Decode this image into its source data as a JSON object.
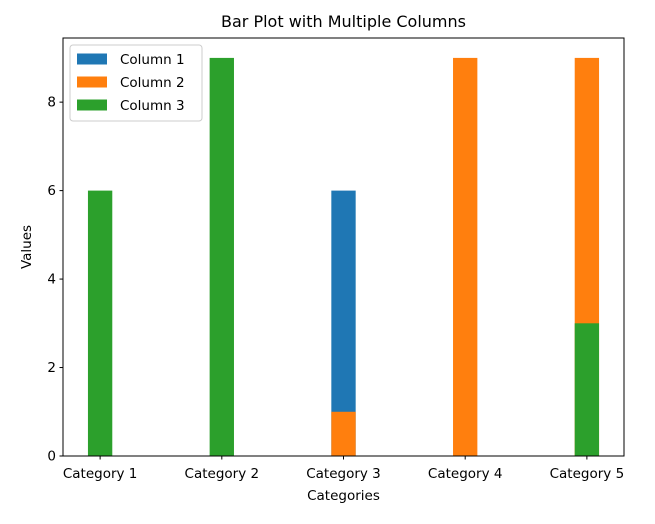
{
  "chart_data": {
    "type": "bar",
    "title": "Bar Plot with Multiple Columns",
    "xlabel": "Categories",
    "ylabel": "Values",
    "categories": [
      "Category 1",
      "Category 2",
      "Category 3",
      "Category 4",
      "Category 5"
    ],
    "series": [
      {
        "name": "Column 1",
        "color": "#1f77b4",
        "values": [
          0,
          0,
          6,
          0,
          0
        ]
      },
      {
        "name": "Column 2",
        "color": "#ff7f0e",
        "values": [
          0,
          0,
          1,
          9,
          9
        ]
      },
      {
        "name": "Column 3",
        "color": "#2ca02c",
        "values": [
          6,
          9,
          0,
          0,
          3
        ]
      }
    ],
    "bar_arrangement": "overlaid (same x position, later series drawn on top)",
    "ylim": [
      0,
      9.45
    ],
    "yticks": [
      0,
      2,
      4,
      6,
      8
    ],
    "grid": false,
    "legend_position": "top-left"
  }
}
